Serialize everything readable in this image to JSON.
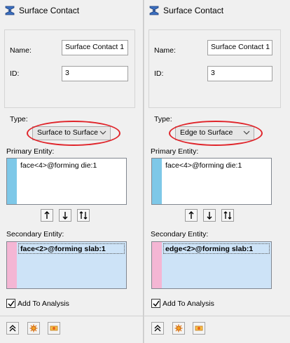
{
  "panels": [
    {
      "title": "Surface Contact",
      "name_label": "Name:",
      "name_value": "Surface Contact 1",
      "id_label": "ID:",
      "id_value": "3",
      "type_label": "Type:",
      "type_value": "Surface to Surface",
      "primary_label": "Primary Entity:",
      "primary_item": "face<4>@forming die:1",
      "secondary_label": "Secondary Entity:",
      "secondary_item": "face<2>@forming slab:1",
      "add_to_analysis_label": "Add To Analysis"
    },
    {
      "title": "Surface Contact",
      "name_label": "Name:",
      "name_value": "Surface Contact 1",
      "id_label": "ID:",
      "id_value": "3",
      "type_label": "Type:",
      "type_value": "Edge to Surface",
      "primary_label": "Primary Entity:",
      "primary_item": "face<4>@forming die:1",
      "secondary_label": "Secondary Entity:",
      "secondary_item": "edge<2>@forming slab:1",
      "add_to_analysis_label": "Add To Analysis"
    }
  ],
  "colors": {
    "primary_strip": "#7ec8e8",
    "secondary_strip": "#f4b6d4",
    "highlight_ring": "#e0242a",
    "selection": "#cde3f7"
  },
  "icons": {
    "title": "surface-contact-icon",
    "entity_tools": [
      "move-up-icon",
      "move-down-icon",
      "swap-icon"
    ],
    "bottom_tools": [
      "collapse-icon",
      "settings-icon",
      "options-icon"
    ]
  }
}
